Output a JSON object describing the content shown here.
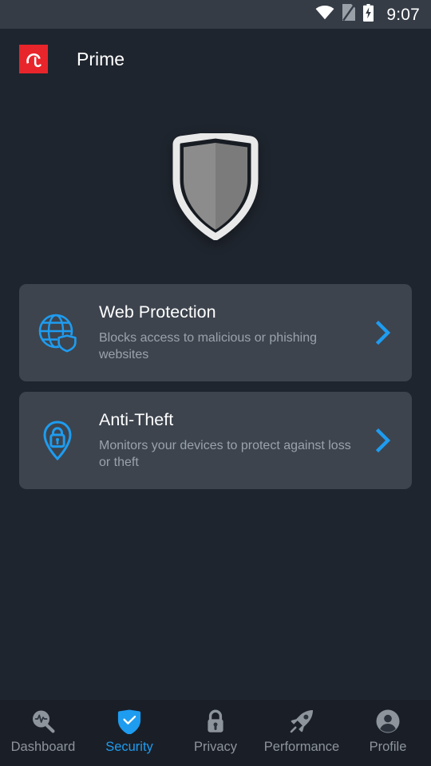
{
  "status_bar": {
    "time": "9:07",
    "icons": [
      "wifi-icon",
      "no-sim-icon",
      "battery-charging-icon"
    ]
  },
  "app_bar": {
    "logo": "avira-umbrella-logo",
    "title": "Prime"
  },
  "hero": {
    "icon": "shield-icon",
    "state": "inactive"
  },
  "colors": {
    "background": "#1f252e",
    "status_bar": "#353c46",
    "card": "#3d444e",
    "nav_bar": "#1a1f27",
    "accent": "#1e9cf0",
    "brand_red": "#e8252b",
    "title_text": "#ffffff",
    "muted_text": "#9ba2aa",
    "shield_light": "#8c8c8c",
    "shield_dark": "#7b7b7b",
    "shield_border": "#e8e8e8"
  },
  "cards": [
    {
      "icon": "globe-shield-icon",
      "title": "Web Protection",
      "subtitle": "Blocks access to malicious or phishing websites",
      "chevron": "chevron-right-icon"
    },
    {
      "icon": "map-pin-lock-icon",
      "title": "Anti-Theft",
      "subtitle": "Monitors your devices to protect against loss or theft",
      "chevron": "chevron-right-icon"
    }
  ],
  "bottom_nav": {
    "active_index": 1,
    "items": [
      {
        "label": "Dashboard",
        "icon": "magnifier-pulse-icon"
      },
      {
        "label": "Security",
        "icon": "shield-check-icon"
      },
      {
        "label": "Privacy",
        "icon": "lock-icon"
      },
      {
        "label": "Performance",
        "icon": "rocket-icon"
      },
      {
        "label": "Profile",
        "icon": "person-avatar-icon"
      }
    ]
  }
}
